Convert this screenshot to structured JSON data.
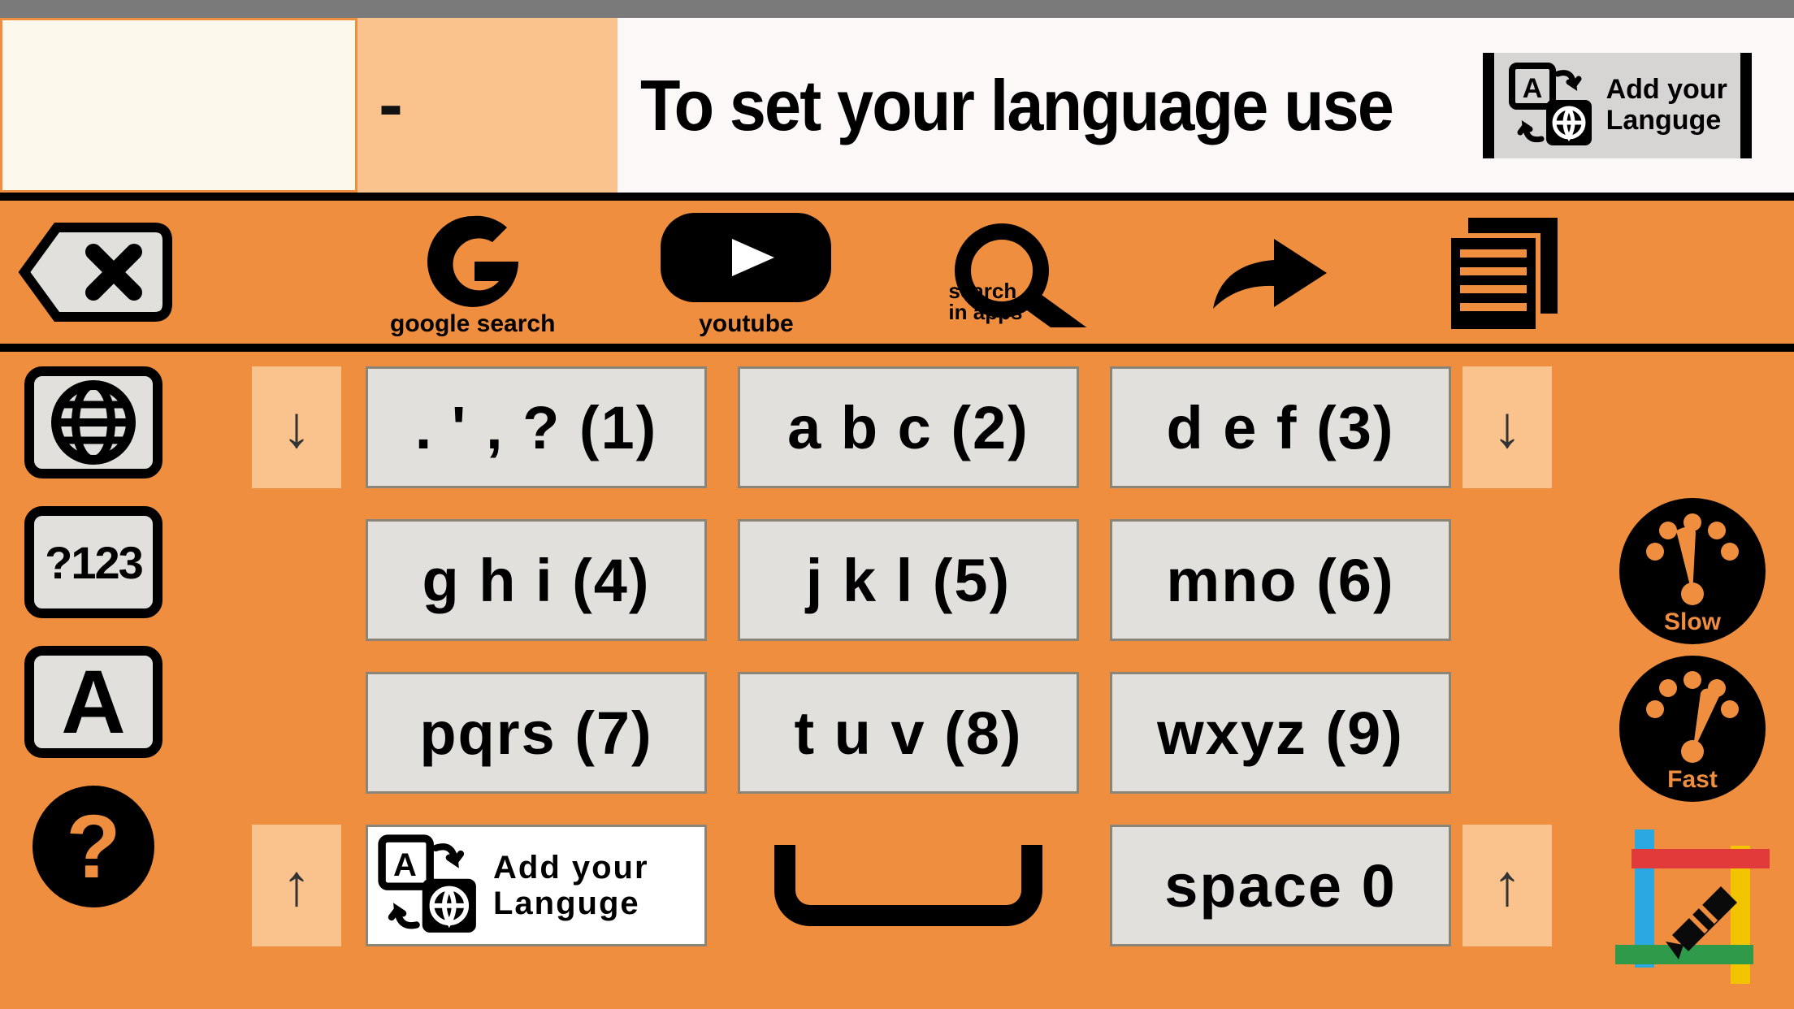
{
  "header": {
    "cell2_text": "-",
    "banner_text": "To set your language use",
    "add_language_line1": "Add your",
    "add_language_line2": "Languge"
  },
  "toolbar": {
    "google_label": "google search",
    "youtube_label": "youtube",
    "search_apps_line1": "search",
    "search_apps_line2": "in apps"
  },
  "sidebar": {
    "numbers_label": "?123",
    "letters_label": "A",
    "help_label": "?"
  },
  "keypad": {
    "keys": [
      ". ' , ? (1)",
      "a b c (2)",
      "d e f (3)",
      "g h i (4)",
      "j k l (5)",
      "mno (6)",
      "pqrs (7)",
      "t u v (8)",
      "wxyz (9)"
    ],
    "space_label": "space 0",
    "add_lang_line1": "Add your",
    "add_lang_line2": "Languge"
  },
  "arrows": {
    "down": "↓",
    "up": "↑"
  },
  "speed": {
    "slow": "Slow",
    "fast": "Fast"
  }
}
